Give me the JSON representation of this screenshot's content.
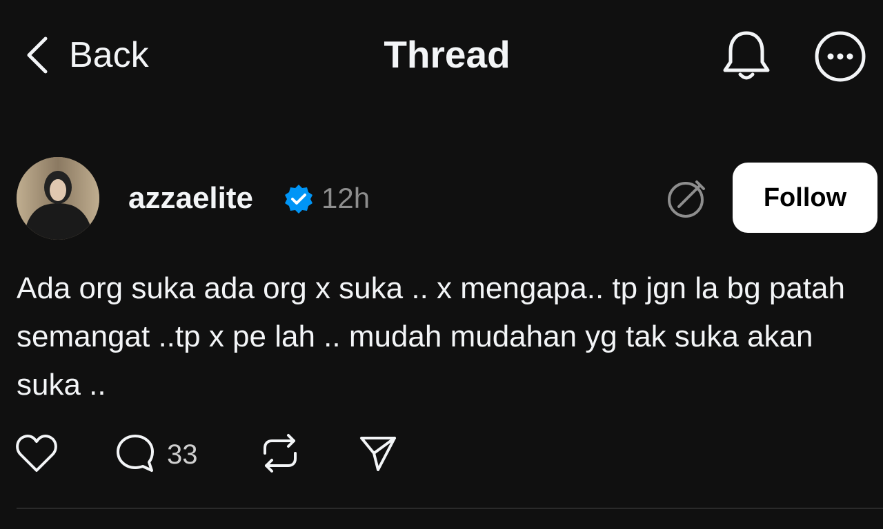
{
  "header": {
    "back_label": "Back",
    "title": "Thread"
  },
  "post": {
    "username": "azzaelite",
    "verified": true,
    "timestamp": "12h",
    "follow_label": "Follow",
    "text": "Ada org suka ada org x suka .. x mengapa.. tp jgn la bg patah semangat ..tp x pe lah .. mudah mudahan yg tak suka akan suka ..",
    "reply_count": "33"
  },
  "icons": {
    "back": "chevron-left-icon",
    "notifications": "bell-icon",
    "more": "more-options-icon",
    "verified": "verified-badge-icon",
    "edit": "edited-indicator-icon",
    "like": "heart-icon",
    "reply": "comment-icon",
    "repost": "repost-icon",
    "share": "send-icon"
  },
  "colors": {
    "background": "#101010",
    "text": "#f3f5f7",
    "muted": "#8e8e8e",
    "verified": "#0095f6",
    "follow_bg": "#ffffff"
  }
}
